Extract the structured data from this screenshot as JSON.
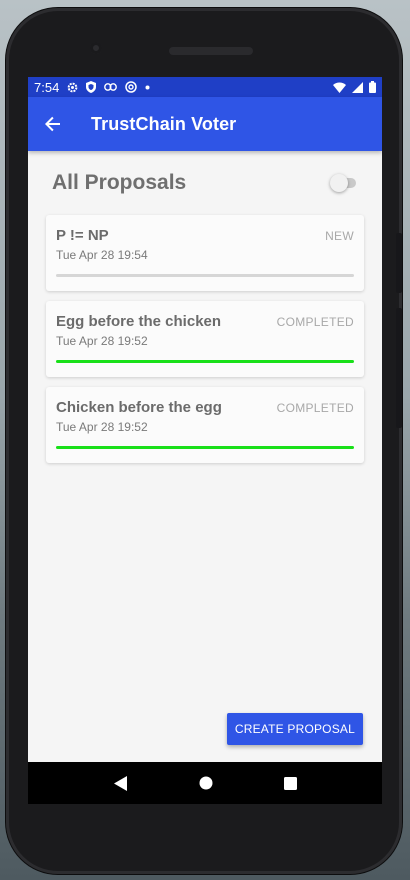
{
  "status_bar": {
    "time": "7:54",
    "icons_left": [
      "gear-icon",
      "shield-icon",
      "link-icon",
      "at-icon",
      "dot-icon"
    ],
    "icons_right": [
      "wifi-icon",
      "signal-icon",
      "battery-icon"
    ]
  },
  "app_bar": {
    "back_icon": "arrow-back-icon",
    "title": "TrustChain Voter",
    "color": "#2f55e6"
  },
  "main": {
    "title": "All Proposals",
    "toggle_on": false,
    "proposals": [
      {
        "title": "P != NP",
        "status": "NEW",
        "date": "Tue Apr 28 19:54",
        "progress": 0
      },
      {
        "title": "Egg before the chicken",
        "status": "COMPLETED",
        "date": "Tue Apr 28 19:52",
        "progress": 1
      },
      {
        "title": "Chicken before the egg",
        "status": "COMPLETED",
        "date": "Tue Apr 28 19:52",
        "progress": 1
      }
    ],
    "progress_color": "#19e019"
  },
  "fab": {
    "label": "CREATE PROPOSAL"
  },
  "nav_bar": {
    "icons": [
      "back-triangle-icon",
      "home-circle-icon",
      "recents-square-icon"
    ]
  }
}
